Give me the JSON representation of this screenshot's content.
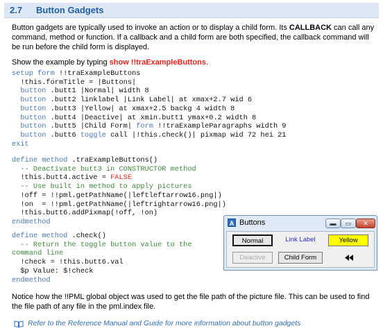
{
  "section": {
    "number": "2.7",
    "title": "Button Gadgets"
  },
  "intro": {
    "t1": "Button gadgets are typically used to invoke an action or to display a child form.  Its ",
    "b1": "CALLBACK",
    "t2": " can call any command, method or function.  If a callback and a child form are both specified, the callback command will be run before the child form is displayed."
  },
  "show": {
    "prefix": "Show the example by typing ",
    "command": "show !!traExampleButtons",
    "suffix": "."
  },
  "code": {
    "l1_kw": "setup form",
    "l1_rest": " !!traExampleButtons",
    "l2": "  !this.formTitle = |Buttons|",
    "l3_kw": "button",
    "l3_rest": " .butt1 |Normal| width 8",
    "l4_kw": "button",
    "l4_rest": " .butt2 linklabel |Link Label| at xmax+2.7 wid 6",
    "l5_kw": "button",
    "l5_rest": " .butt3 |Yellow| at xmax+2.5 backg 4 width 8",
    "l6_kw": "button",
    "l6_rest": " .butt4 |Deactive| at xmin.butt1 ymax+0.2 width 8",
    "l7_kw": "button",
    "l7_rest1": " .butt5 |Child Form| ",
    "l7_kw2": "form",
    "l7_rest2": " !!traExampleParagraphs width 9",
    "l8_kw": "button",
    "l8_rest1": " .butt6 ",
    "l8_kw2": "toggle",
    "l8_rest2": " call |!this.check()| pixmap wid 72 hei 21",
    "l9_kw": "exit",
    "m1_kw": "define method",
    "m1_rest": " .traExampleButtons()",
    "m2_cm": "  -- Deactivate butt3 in CONSTRUCTOR method",
    "m3_a": "  !this.butt4.active = ",
    "m3_red": "FALSE",
    "m4_cm": "  -- Use built in method to apply pictures",
    "m5": "  !off = !!pml.getPathName(|leftleftarrow16.png|)",
    "m6": "  !on  = !!pml.getPathName(|leftrightarrow16.png|)",
    "m7": "  !this.butt6.addPixmap(!off, !on)",
    "m8_kw": "endmethod",
    "c1_kw": "define method",
    "c1_rest": " .check()",
    "c2_cm": "  -- Return the toggle button value to the",
    "c3_cm": "command line",
    "c4": "  !check = !this.butt6.val",
    "c5": "  $p Value: $!check",
    "c6_kw": "endmethod"
  },
  "window": {
    "title": "Buttons",
    "icon_letter": "A",
    "controls": {
      "minimize": "▬",
      "maximize": "▭",
      "close": "✕"
    },
    "buttons": {
      "normal": "Normal",
      "link": "Link Label",
      "yellow": "Yellow",
      "deactive": "Deactive",
      "child": "Child Form",
      "toggle_icon": "leftleftarrow-icon"
    }
  },
  "notice": "Notice how the !!PML global object was used to get the file path of the picture file. This can be used to find the file path of any file in the pml.index file.",
  "reference": "Refer to the Reference Manual and Guide for more information about button gadgets"
}
